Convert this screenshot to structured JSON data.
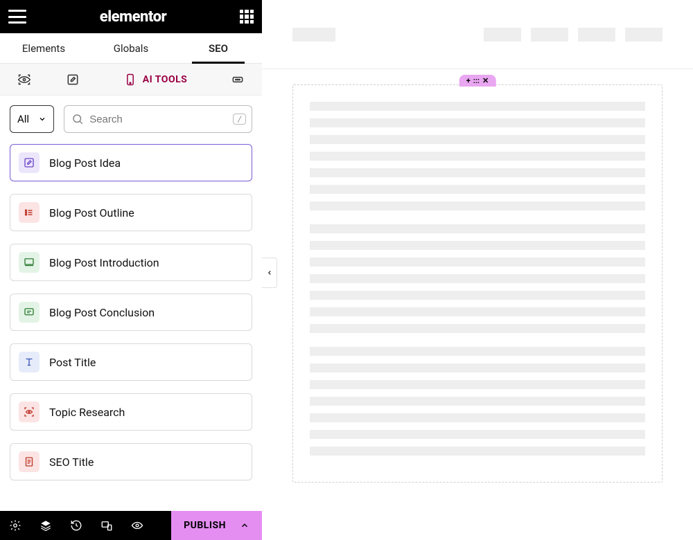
{
  "header": {
    "brand": "elementor"
  },
  "tabs": [
    {
      "label": "Elements"
    },
    {
      "label": "Globals"
    },
    {
      "label": "SEO",
      "active": true
    }
  ],
  "toolbar": {
    "ai_label": "AI TOOLS"
  },
  "filter": {
    "selected": "All"
  },
  "search": {
    "placeholder": "Search",
    "shortcut": "/"
  },
  "widgets": [
    {
      "label": "Blog Post Idea",
      "icon": "compose-icon",
      "icon_class": "ic-purple",
      "selected": true
    },
    {
      "label": "Blog Post Outline",
      "icon": "list-icon",
      "icon_class": "ic-red"
    },
    {
      "label": "Blog Post Introduction",
      "icon": "screen-icon",
      "icon_class": "ic-green"
    },
    {
      "label": "Blog Post Conclusion",
      "icon": "chat-icon",
      "icon_class": "ic-green"
    },
    {
      "label": "Post Title",
      "icon": "type-icon",
      "icon_class": "ic-blue"
    },
    {
      "label": "Topic Research",
      "icon": "scan-eye-icon",
      "icon_class": "ic-red"
    },
    {
      "label": "SEO Title",
      "icon": "doc-icon",
      "icon_class": "ic-red"
    }
  ],
  "footer": {
    "publish_label": "PUBLISH"
  },
  "section_controls": {
    "add": "+",
    "drag": ":::",
    "close": "✕"
  }
}
